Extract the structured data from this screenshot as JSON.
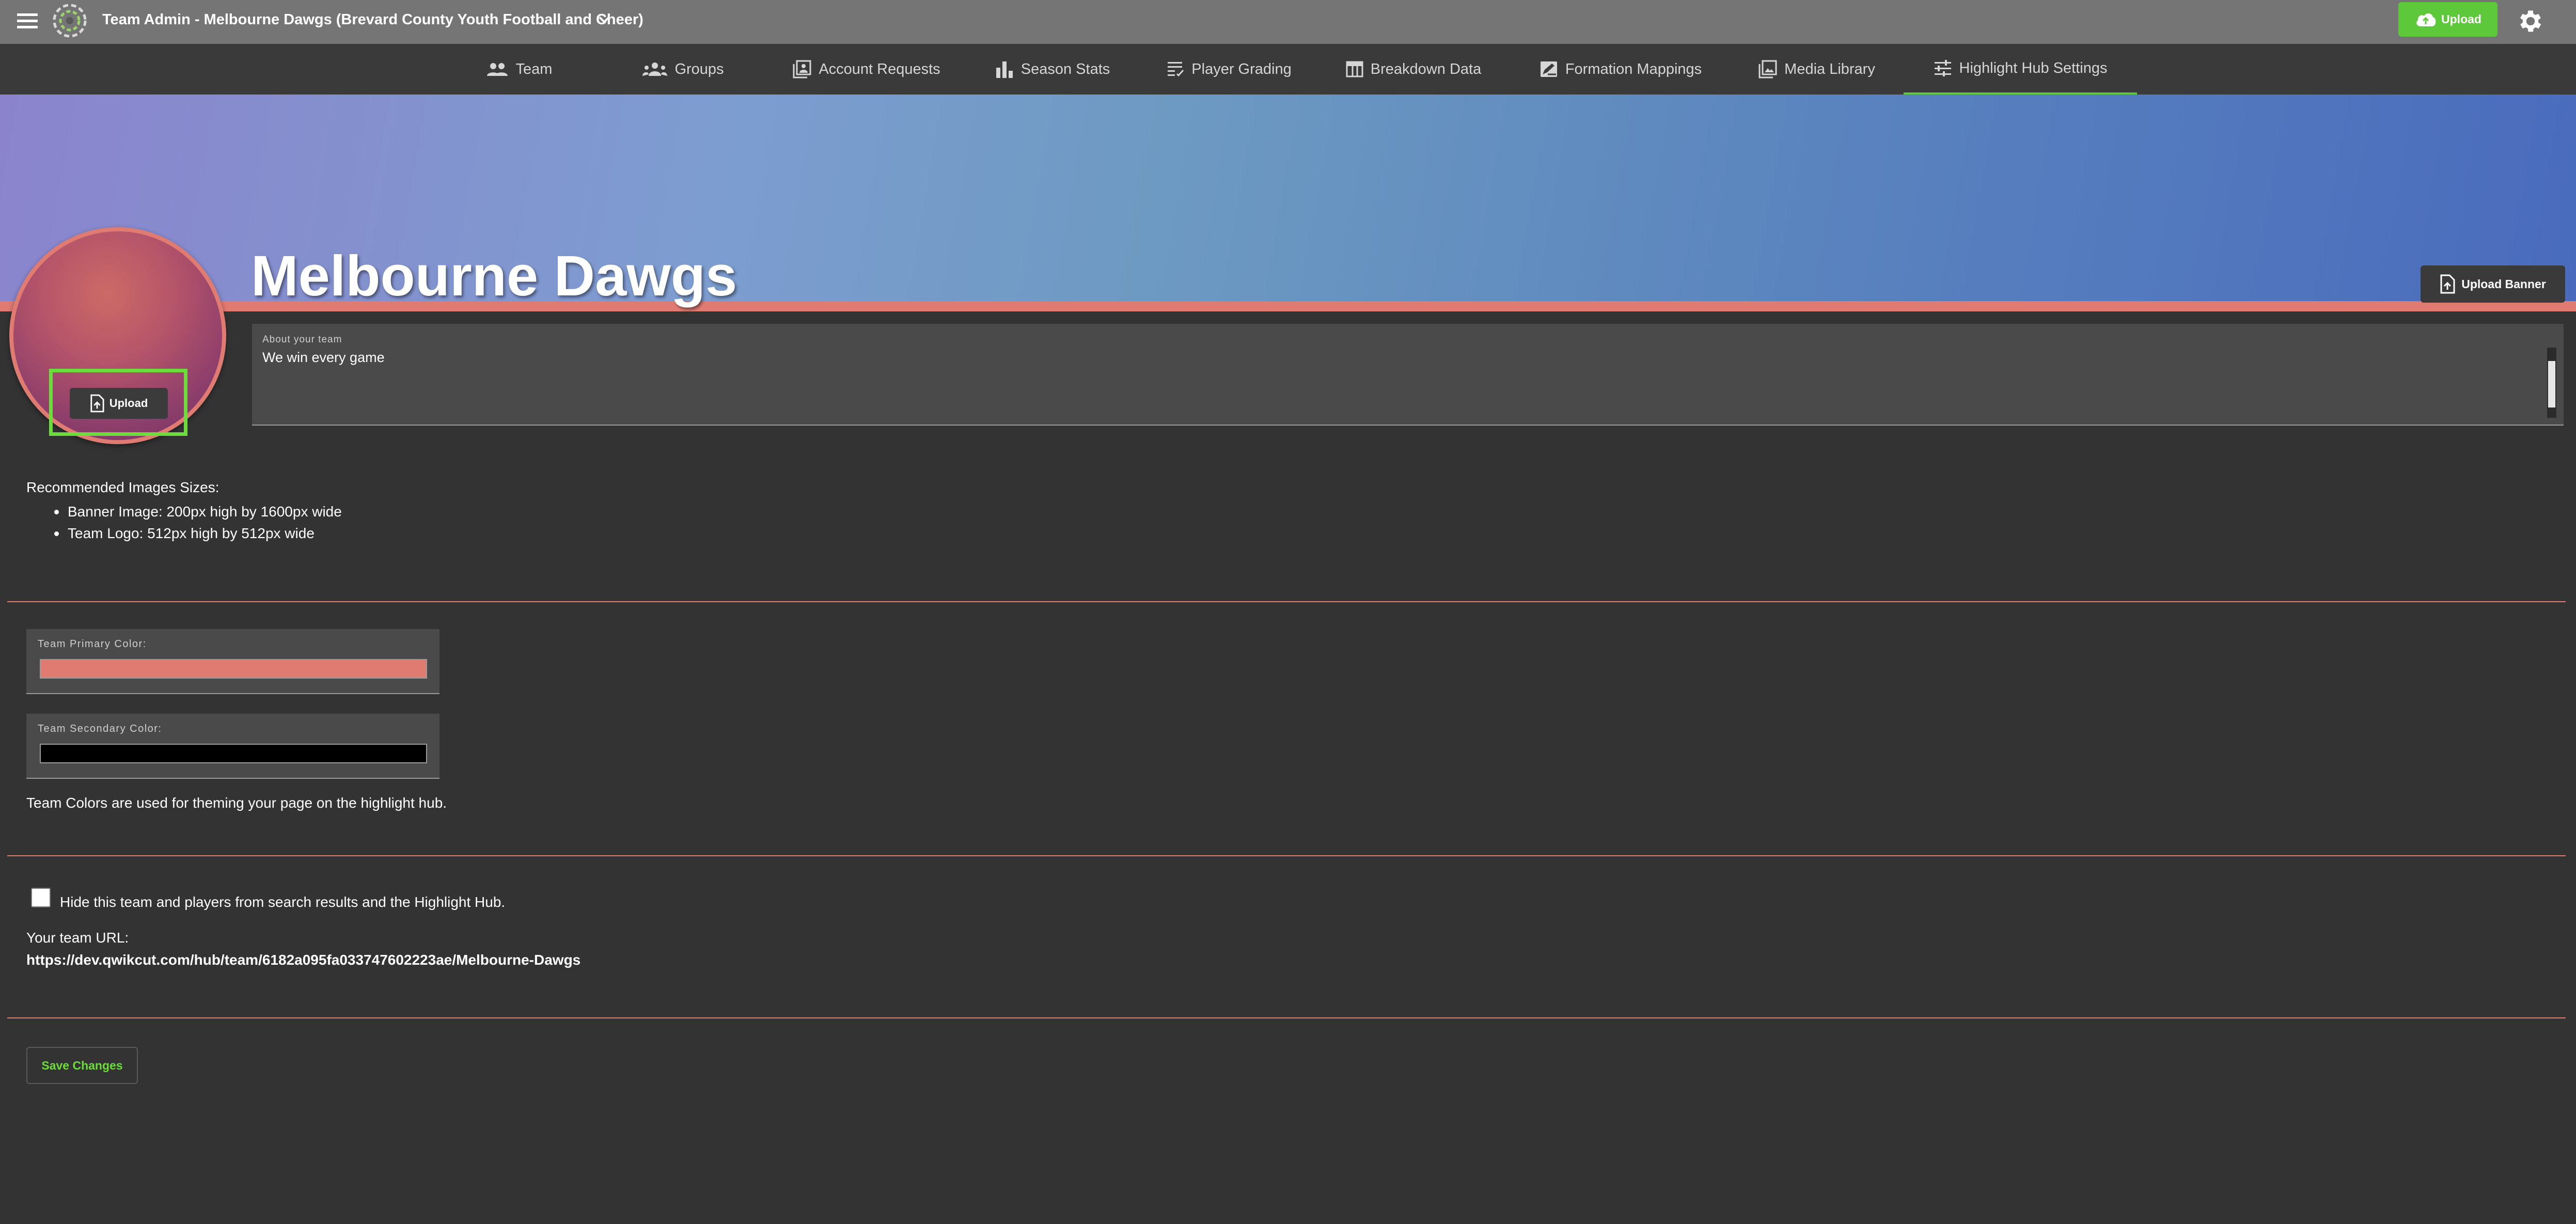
{
  "header": {
    "title": "Team Admin - Melbourne Dawgs (Brevard County Youth Football and Cheer)",
    "upload_label": "Upload",
    "icons": {
      "menu": "hamburger-menu-icon",
      "logo": "qwikcut-logo-icon",
      "dropdown": "chevron-down-icon",
      "upload": "cloud-upload-icon",
      "settings": "gear-icon"
    },
    "accent_color": "#5cc83a"
  },
  "tabs": [
    {
      "label": "Team",
      "icon": "people-icon"
    },
    {
      "label": "Groups",
      "icon": "groups-icon"
    },
    {
      "label": "Account Requests",
      "icon": "account-box-icon"
    },
    {
      "label": "Season Stats",
      "icon": "bar-chart-icon"
    },
    {
      "label": "Player Grading",
      "icon": "grading-icon"
    },
    {
      "label": "Breakdown Data",
      "icon": "table-icon"
    },
    {
      "label": "Formation Mappings",
      "icon": "draw-icon"
    },
    {
      "label": "Media Library",
      "icon": "photo-library-icon"
    },
    {
      "label": "Highlight Hub Settings",
      "icon": "tune-icon",
      "active": true
    }
  ],
  "banner": {
    "team_name": "Melbourne Dawgs",
    "upload_banner_label": "Upload Banner",
    "avatar_upload_label": "Upload"
  },
  "about": {
    "label": "About your team",
    "value": "We win every game"
  },
  "recommended": {
    "title": "Recommended Images Sizes:",
    "items": [
      "Banner Image: 200px high by 1600px wide",
      "Team Logo: 512px high by 512px wide"
    ]
  },
  "colors": {
    "primary_label": "Team Primary Color:",
    "primary_value": "#e07b72",
    "secondary_label": "Team Secondary Color:",
    "secondary_value": "#000000",
    "note": "Team Colors are used for theming your page on the highlight hub."
  },
  "visibility": {
    "hide_label": "Hide this team and players from search results and the Highlight Hub.",
    "hide_checked": false,
    "url_label": "Your team URL:",
    "url_value": "https://dev.qwikcut.com/hub/team/6182a095fa033747602223ae/Melbourne-Dawgs"
  },
  "actions": {
    "save_label": "Save Changes"
  }
}
